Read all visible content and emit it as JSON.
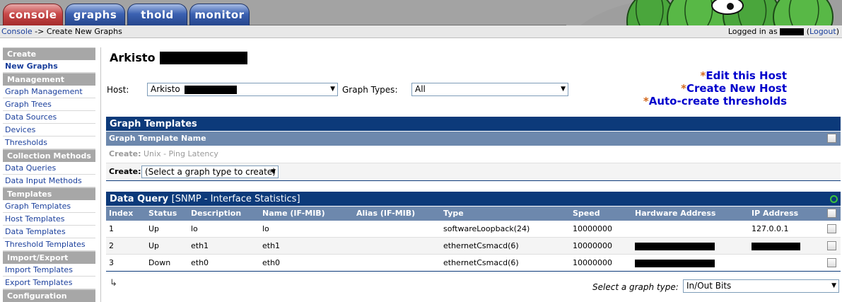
{
  "tabs": [
    {
      "label": "console",
      "color": "red"
    },
    {
      "label": "graphs",
      "color": "blue"
    },
    {
      "label": "thold",
      "color": "blue"
    },
    {
      "label": "monitor",
      "color": "blue"
    }
  ],
  "breadcrumb": {
    "root": "Console",
    "separator": "->",
    "current": "Create New Graphs"
  },
  "login": {
    "prefix": "Logged in as",
    "logout_label": "Logout"
  },
  "sidebar": {
    "sections": [
      {
        "header": "Create",
        "items": [
          "New Graphs"
        ]
      },
      {
        "header": "Management",
        "items": [
          "Graph Management",
          "Graph Trees",
          "Data Sources",
          "Devices",
          "Thresholds"
        ]
      },
      {
        "header": "Collection Methods",
        "items": [
          "Data Queries",
          "Data Input Methods"
        ]
      },
      {
        "header": "Templates",
        "items": [
          "Graph Templates",
          "Host Templates",
          "Data Templates",
          "Threshold Templates"
        ]
      },
      {
        "header": "Import/Export",
        "items": [
          "Import Templates",
          "Export Templates"
        ]
      },
      {
        "header": "Configuration",
        "items": []
      }
    ]
  },
  "main": {
    "host_title": "Arkisto",
    "host_label": "Host:",
    "host_value": "Arkisto",
    "graph_types_label": "Graph Types:",
    "graph_types_value": "All",
    "actions": [
      "Edit this Host",
      "Create New Host",
      "Auto-create thresholds"
    ],
    "action_star": "*"
  },
  "graph_templates": {
    "title": "Graph Templates",
    "column_header": "Graph Template Name",
    "row1_prefix": "Create:",
    "row1_text": "Unix - Ping Latency",
    "row2_prefix": "Create:",
    "row2_select": "(Select a graph type to create)"
  },
  "data_query": {
    "title": "Data Query",
    "subtitle": "[SNMP - Interface Statistics]",
    "columns": [
      "Index",
      "Status",
      "Description",
      "Name (IF-MIB)",
      "Alias (IF-MIB)",
      "Type",
      "Speed",
      "Hardware Address",
      "IP Address"
    ],
    "rows": [
      {
        "index": "1",
        "status": "Up",
        "description": "lo",
        "name": "lo",
        "alias": "",
        "type": "softwareLoopback(24)",
        "speed": "10000000",
        "hw": "",
        "ip": "127.0.0.1"
      },
      {
        "index": "2",
        "status": "Up",
        "description": "eth1",
        "name": "eth1",
        "alias": "",
        "type": "ethernetCsmacd(6)",
        "speed": "10000000",
        "hw": "",
        "ip": ""
      },
      {
        "index": "3",
        "status": "Down",
        "description": "eth0",
        "name": "eth0",
        "alias": "",
        "type": "ethernetCsmacd(6)",
        "speed": "10000000",
        "hw": "",
        "ip": ""
      }
    ],
    "select_label": "Select a graph type:",
    "select_value": "In/Out Bits"
  },
  "colors": {
    "panel_header": "#0c3a7a",
    "column_header": "#6d88ad",
    "link": "#1a3f9c",
    "action_link": "#0000cc",
    "action_star": "#d2691e"
  }
}
